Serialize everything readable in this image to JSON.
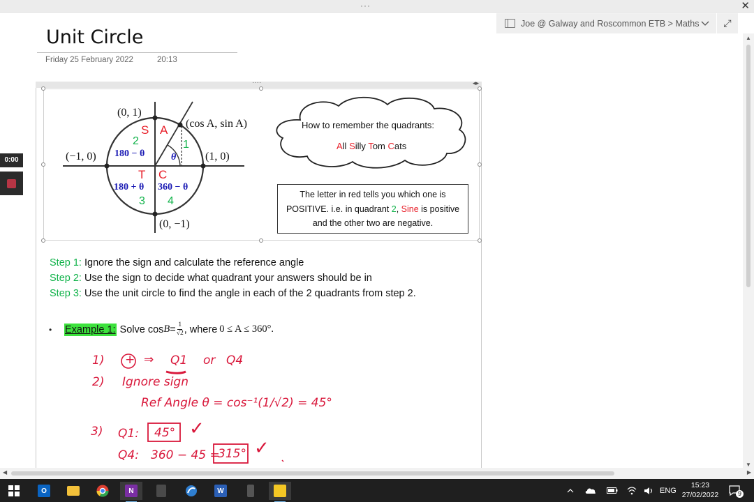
{
  "window": {
    "menu_dots": "···",
    "close_glyph": "✕",
    "notebook_path": "Joe @ Galway and Roscommon ETB > Maths",
    "expand_glyph": "⤢"
  },
  "page": {
    "title": "Unit Circle",
    "date": "Friday 25 February 2022",
    "time": "20:13"
  },
  "recording": {
    "elapsed": "0:00"
  },
  "diagram": {
    "labels": {
      "top": "(0, 1)",
      "left": "(−1, 0)",
      "right": "(1, 0)",
      "bottom": "(0, −1)",
      "point": "(cos A, sin A)",
      "q1": "1",
      "q2": "2",
      "q3": "3",
      "q4": "4",
      "S": "S",
      "A": "A",
      "T": "T",
      "C": "C",
      "theta": "θ",
      "q2_angle": "180 − θ",
      "q3_angle": "180 + θ",
      "q4_angle": "360 − θ"
    },
    "colors": {
      "red": "#e8202a",
      "green": "#12b34b",
      "blue": "#1a1ab4"
    }
  },
  "cloud": {
    "line1": "How to remember the quadrants:",
    "word1_first": "A",
    "word1_rest": "ll",
    "word2_first": "S",
    "word2_rest": "illy",
    "word3_first": "T",
    "word3_rest": "om",
    "word4_first": "C",
    "word4_rest": "ats"
  },
  "note": {
    "part1": "The letter in red tells you which one is POSITIVE. i.e. in quadrant ",
    "quadrant": "2",
    "comma": ", ",
    "sine": "Sine",
    "part2": " is positive and the other two are negative."
  },
  "steps": [
    {
      "label": "Step 1:",
      "text": " Ignore the sign and calculate the reference angle"
    },
    {
      "label": "Step 2:",
      "text": " Use the sign to decide what quadrant your answers should be in"
    },
    {
      "label": "Step 3:",
      "text": " Use the unit circle to find the angle in each of the 2 quadrants from step 2."
    }
  ],
  "example": {
    "bullet": "•",
    "label": "Example 1:",
    "text_before": "Solve cos",
    "var": "B",
    "equals": "=",
    "frac_num": "1",
    "frac_den": "√2",
    "text_after": ", where ",
    "condition": "0 ≤ A ≤ 360°."
  },
  "handwriting": {
    "l1_num": "1)",
    "l1_plus": "+",
    "l1_arrow": "⇒",
    "l1_q1": "Q1",
    "l1_or": "or",
    "l1_q4": "Q4",
    "l2_num": "2)",
    "l2_text": "Ignore  sign",
    "l3_text": "Ref Angle θ  =  cos⁻¹(1/√2) =  45°",
    "l4_num": "3)",
    "l4_q1": "Q1:",
    "l4_ans": "45°",
    "l4_tick": "✓",
    "l5_q4": "Q4:",
    "l5_calc": "360 − 45 =",
    "l5_ans": "315°",
    "l5_tick": "✓"
  },
  "taskbar": {
    "apps": [
      "start",
      "outlook",
      "file-explorer",
      "chrome",
      "onenote",
      "calculator",
      "remote-desktop",
      "word",
      "phone",
      "sticky-notes"
    ],
    "tray": {
      "language": "ENG",
      "time": "15:23",
      "date": "27/02/2022",
      "notifications": "9"
    }
  }
}
